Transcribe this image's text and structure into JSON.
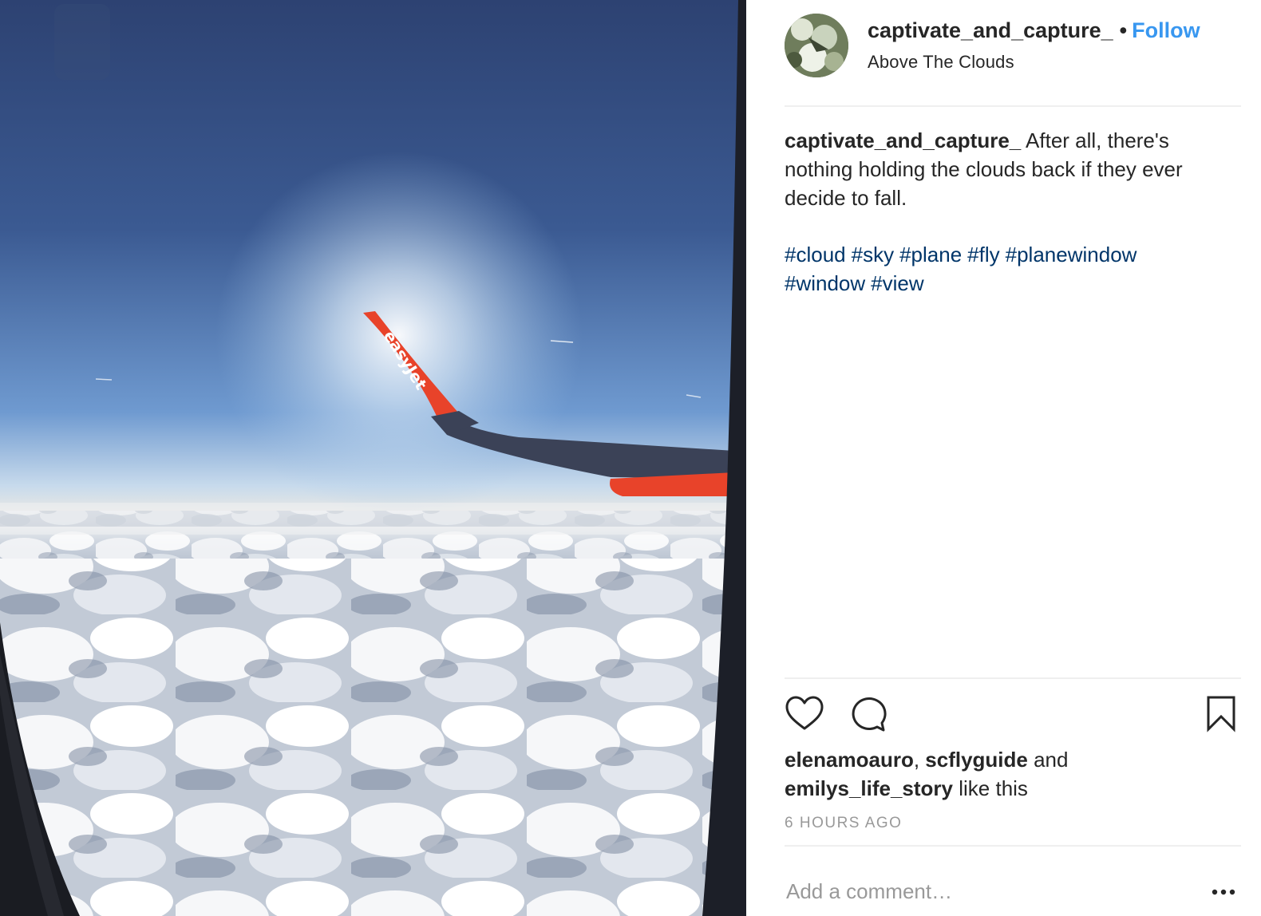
{
  "post": {
    "username": "captivate_and_capture_",
    "separator": "•",
    "follow_label": "Follow",
    "location": "Above The Clouds",
    "caption_user": "captivate_and_capture_",
    "caption_text": " After all, there's nothing holding the clouds back if they ever decide to fall.",
    "hashtags": [
      "#cloud",
      "#sky",
      "#plane",
      "#fly",
      "#planewindow",
      "#window",
      "#view"
    ],
    "likes": {
      "user1": "elenamoauro",
      "sep1": ", ",
      "user2": "scflyguide",
      "sep2": " and ",
      "user3": "emilys_life_story",
      "suffix": " like this"
    },
    "timestamp": "6 HOURS AGO",
    "comment_placeholder": "Add a comment…",
    "photo_wingtip_text": "easyJet"
  },
  "icons": {
    "like": "heart-icon",
    "comment": "comment-bubble-icon",
    "save": "bookmark-icon",
    "more": "more-options-icon"
  },
  "colors": {
    "follow": "#3897f0",
    "hashtag": "#003569",
    "muted": "#999999",
    "text": "#262626",
    "winglet": "#e8432a"
  }
}
